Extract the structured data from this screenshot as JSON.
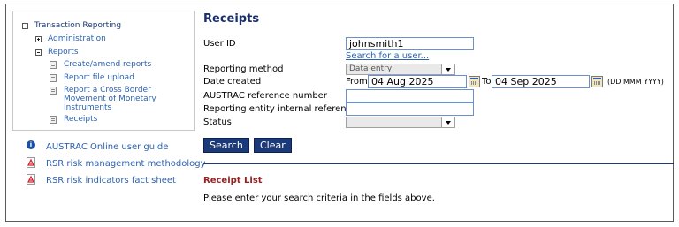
{
  "sidebar": {
    "tree_root": "Transaction Reporting",
    "administration": "Administration",
    "reports": "Reports",
    "items": [
      {
        "label": "Create/amend reports"
      },
      {
        "label": "Report file upload"
      },
      {
        "label": "Report a Cross Border Movement of Monetary Instruments"
      },
      {
        "label": "Receipts"
      }
    ],
    "cross_border_lines": [
      "Report a Cross Border",
      "Movement of Monetary",
      "Instruments"
    ],
    "links": {
      "guide": "AUSTRAC Online user guide",
      "rsr_methodology": "RSR risk management methodology",
      "rsr_factsheet": "RSR risk indicators fact sheet"
    }
  },
  "main": {
    "title": "Receipts",
    "user_id_label": "User ID",
    "user_id_value": "johnsmith1",
    "search_user_link": "Search for a user...",
    "reporting_method_label": "Reporting method",
    "reporting_method_value": "Data entry",
    "date_created_label": "Date created",
    "from_label": "From",
    "from_value": "04 Aug 2025",
    "to_label": "To",
    "to_value": "04 Sep 2025",
    "date_format": "(DD MMM YYYY)",
    "austrac_ref_label": "AUSTRAC reference number",
    "austrac_ref_value": "",
    "entity_ref_label": "Reporting entity internal reference",
    "entity_ref_value": "",
    "status_label": "Status",
    "status_value": "",
    "search_button": "Search",
    "clear_button": "Clear",
    "receipt_list_heading": "Receipt List",
    "receipt_list_message": "Please enter your search criteria in the fields above."
  }
}
